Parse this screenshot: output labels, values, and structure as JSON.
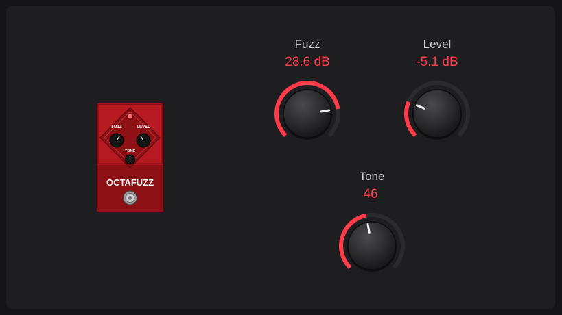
{
  "pedal": {
    "brand": "OCTAFUZZ",
    "fuzz_label": "FUZZ",
    "level_label": "LEVEL",
    "tone_label": "TONE"
  },
  "controls": {
    "fuzz": {
      "label": "Fuzz",
      "value": "28.6 dB",
      "fraction": 0.8
    },
    "level": {
      "label": "Level",
      "value": "-5.1 dB",
      "fraction": 0.25
    },
    "tone": {
      "label": "Tone",
      "value": "46",
      "fraction": 0.46
    }
  },
  "colors": {
    "accent": "#ff3b4a",
    "track": "#2b2b2e",
    "pedal_body": "#a8141a"
  },
  "icons": {
    "footswitch": "footswitch-icon",
    "led": "led-icon"
  }
}
